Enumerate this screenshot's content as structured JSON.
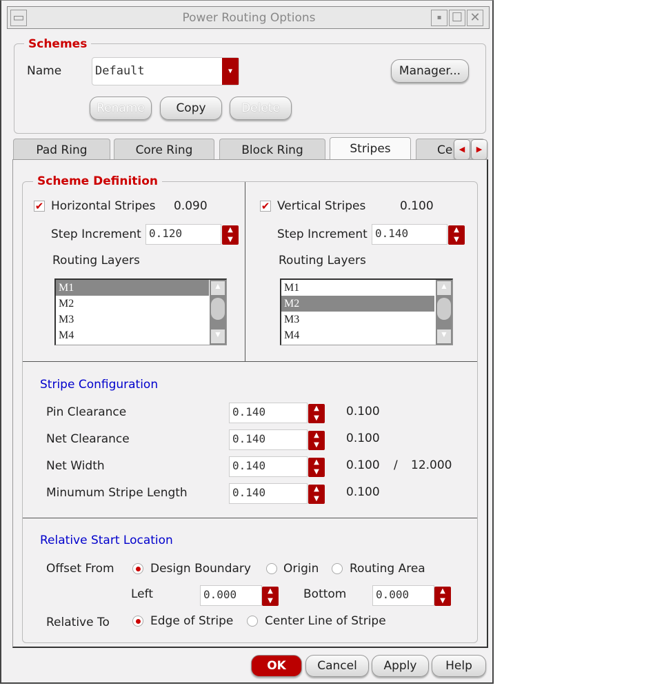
{
  "window": {
    "title": "Power Routing Options"
  },
  "schemes": {
    "legend": "Schemes",
    "name_label": "Name",
    "name_value": "Default",
    "manager": "Manager...",
    "rename": "Rename",
    "copy": "Copy",
    "delete": "Delete"
  },
  "tabs": [
    {
      "label": "Pad Ring"
    },
    {
      "label": "Core Ring"
    },
    {
      "label": "Block Ring"
    },
    {
      "label": "Stripes",
      "active": true
    },
    {
      "label": "Ce"
    }
  ],
  "scheme_def": {
    "legend": "Scheme Definition",
    "horizontal": {
      "label": "Horizontal Stripes",
      "checked": true,
      "value": "0.090",
      "step_label": "Step Increment",
      "step": "0.120",
      "layers_label": "Routing Layers",
      "layers": [
        "M1",
        "M2",
        "M3",
        "M4"
      ],
      "selected": "M1"
    },
    "vertical": {
      "label": "Vertical Stripes",
      "checked": true,
      "value": "0.100",
      "step_label": "Step Increment",
      "step": "0.140",
      "layers_label": "Routing Layers",
      "layers": [
        "M1",
        "M2",
        "M3",
        "M4"
      ],
      "selected": "M2"
    }
  },
  "stripe_config": {
    "title": "Stripe Configuration",
    "rows": [
      {
        "label": "Pin Clearance",
        "value": "0.140",
        "min": "0.100"
      },
      {
        "label": "Net Clearance",
        "value": "0.140",
        "min": "0.100"
      },
      {
        "label": "Net Width",
        "value": "0.140",
        "min": "0.100",
        "sep": "/",
        "max": "12.000"
      },
      {
        "label": "Minumum Stripe Length",
        "value": "0.140",
        "min": "0.100"
      }
    ]
  },
  "start_location": {
    "title": "Relative Start Location",
    "offset_label": "Offset From",
    "offset_options": [
      "Design Boundary",
      "Origin",
      "Routing Area"
    ],
    "offset_selected": "Design Boundary",
    "left_label": "Left",
    "left": "0.000",
    "bottom_label": "Bottom",
    "bottom": "0.000",
    "relative_label": "Relative To",
    "relative_options": [
      "Edge of Stripe",
      "Center Line of Stripe"
    ],
    "relative_selected": "Edge of Stripe"
  },
  "footer": {
    "ok": "OK",
    "cancel": "Cancel",
    "apply": "Apply",
    "help": "Help"
  },
  "colors": {
    "accent": "#aa0000",
    "section_title": "#0000cc",
    "legend": "#cc0000"
  }
}
